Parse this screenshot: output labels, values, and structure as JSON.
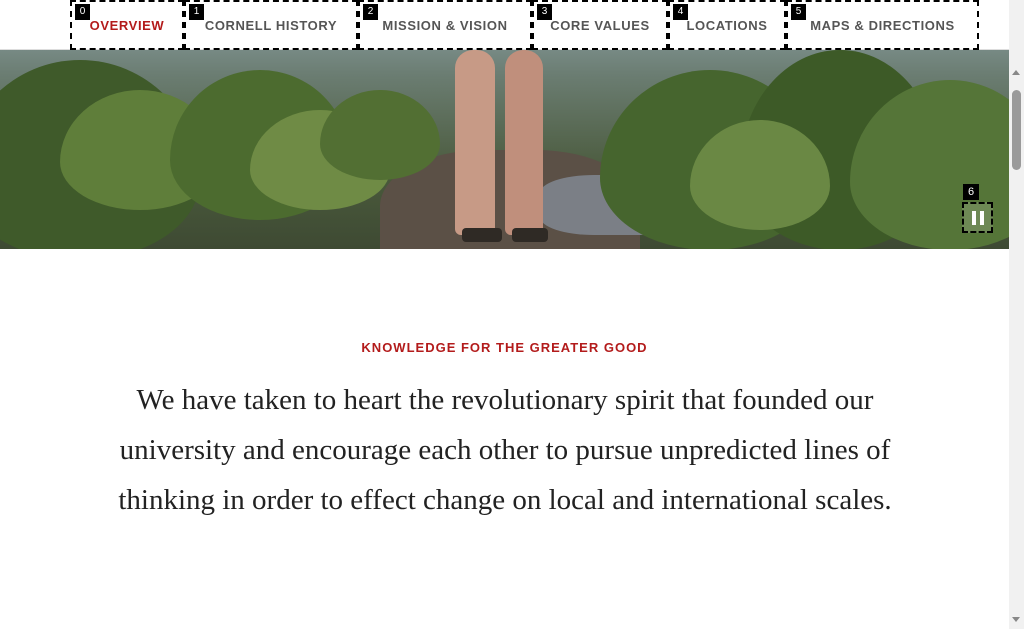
{
  "nav": {
    "tabs": [
      {
        "num": "0",
        "label": "OVERVIEW"
      },
      {
        "num": "1",
        "label": "CORNELL HISTORY"
      },
      {
        "num": "2",
        "label": "MISSION & VISION"
      },
      {
        "num": "3",
        "label": "CORE VALUES"
      },
      {
        "num": "4",
        "label": "LOCATIONS"
      },
      {
        "num": "5",
        "label": "MAPS & DIRECTIONS"
      }
    ],
    "active_index": 0
  },
  "hero": {
    "pause_tag": "6",
    "pause_icon": "pause-icon"
  },
  "content": {
    "eyebrow": "KNOWLEDGE FOR THE GREATER GOOD",
    "lead": "We have taken to heart the revolutionary spirit that founded our university and encourage each other to pursue unpredicted lines of thinking in order to effect change on local and international scales."
  },
  "colors": {
    "accent": "#b31b1b",
    "text": "#222222",
    "nav_text": "#555555"
  }
}
